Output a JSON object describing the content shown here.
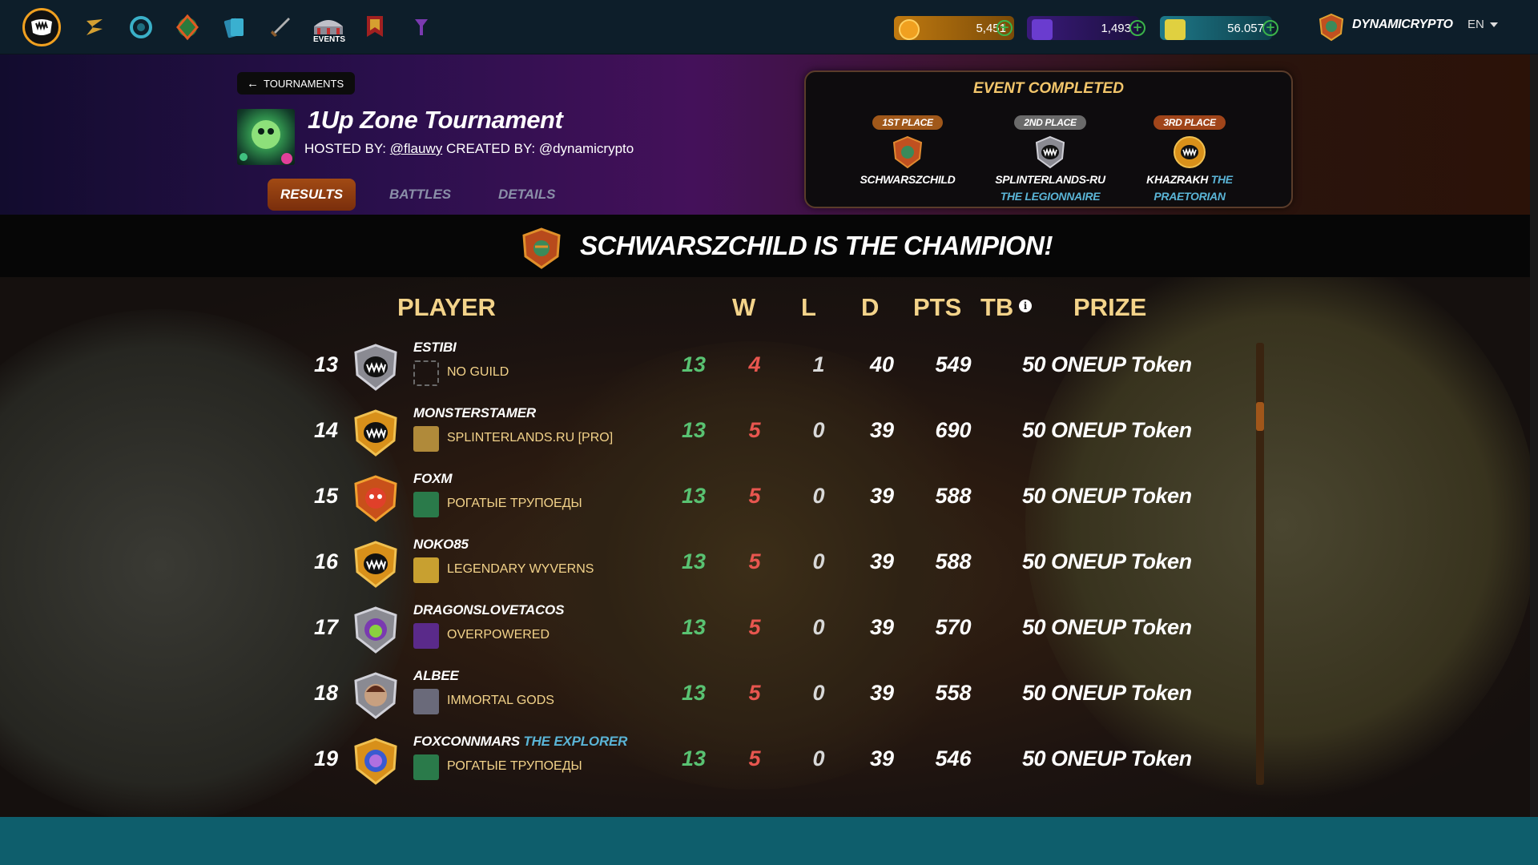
{
  "nav": {
    "events_label": "EVENTS",
    "currencies": [
      {
        "name": "dec",
        "value": "5,451",
        "color": "#f0a020"
      },
      {
        "name": "sps",
        "value": "1,493",
        "color": "#6a3ccf"
      },
      {
        "name": "credits",
        "value": "56.057",
        "color": "#2a9cb4"
      }
    ],
    "username": "DYNAMICRYPTO",
    "language": "EN"
  },
  "header": {
    "back_label": "TOURNAMENTS",
    "title": "1Up Zone Tournament",
    "hosted_prefix": "HOSTED BY:",
    "host": "@flauwy",
    "created_prefix": "CREATED BY:",
    "creator": "@dynamicrypto",
    "tabs": [
      "RESULTS",
      "BATTLES",
      "DETAILS"
    ]
  },
  "event": {
    "title": "EVENT COMPLETED",
    "places": [
      {
        "badge": "1ST PLACE",
        "name": "SCHWARSZCHILD",
        "sub": ""
      },
      {
        "badge": "2ND PLACE",
        "name": "SPLINTERLANDS-RU",
        "sub": "THE LEGIONNAIRE"
      },
      {
        "badge": "3RD PLACE",
        "name": "KHAZRAKH",
        "sub": "THE PRAETORIAN"
      }
    ]
  },
  "champion_text": "SCHWARSZCHILD IS THE CHAMPION!",
  "table": {
    "headers": {
      "player": "PLAYER",
      "w": "W",
      "l": "L",
      "d": "D",
      "pts": "PTS",
      "tb": "TB",
      "prize": "PRIZE"
    },
    "rows": [
      {
        "rank": "13",
        "name": "ESTIBI",
        "title": "",
        "guild": "NO GUILD",
        "w": "13",
        "l": "4",
        "d": "1",
        "pts": "40",
        "tb": "549",
        "prize": "50 ONEUP Token"
      },
      {
        "rank": "14",
        "name": "MONSTERSTAMER",
        "title": "",
        "guild": "SPLINTERLANDS.RU [PRO]",
        "w": "13",
        "l": "5",
        "d": "0",
        "pts": "39",
        "tb": "690",
        "prize": "50 ONEUP Token"
      },
      {
        "rank": "15",
        "name": "FOXM",
        "title": "",
        "guild": "РОГАТЫЕ ТРУПОЕДЫ",
        "w": "13",
        "l": "5",
        "d": "0",
        "pts": "39",
        "tb": "588",
        "prize": "50 ONEUP Token"
      },
      {
        "rank": "16",
        "name": "NOKO85",
        "title": "",
        "guild": "LEGENDARY WYVERNS",
        "w": "13",
        "l": "5",
        "d": "0",
        "pts": "39",
        "tb": "588",
        "prize": "50 ONEUP Token"
      },
      {
        "rank": "17",
        "name": "DRAGONSLOVETACOS",
        "title": "",
        "guild": "OVERPOWERED",
        "w": "13",
        "l": "5",
        "d": "0",
        "pts": "39",
        "tb": "570",
        "prize": "50 ONEUP Token"
      },
      {
        "rank": "18",
        "name": "ALBEE",
        "title": "",
        "guild": "IMMORTAL GODS",
        "w": "13",
        "l": "5",
        "d": "0",
        "pts": "39",
        "tb": "558",
        "prize": "50 ONEUP Token"
      },
      {
        "rank": "19",
        "name": "FOXCONNMARS",
        "title": "THE EXPLORER",
        "guild": "РОГАТЫЕ ТРУПОЕДЫ",
        "w": "13",
        "l": "5",
        "d": "0",
        "pts": "39",
        "tb": "546",
        "prize": "50 ONEUP Token"
      }
    ]
  },
  "colors": {
    "win": "#59c272",
    "loss": "#e8564f",
    "header_gold": "#f3d38a",
    "accent_orange": "#a24a14",
    "footer": "#0e5e6c"
  }
}
